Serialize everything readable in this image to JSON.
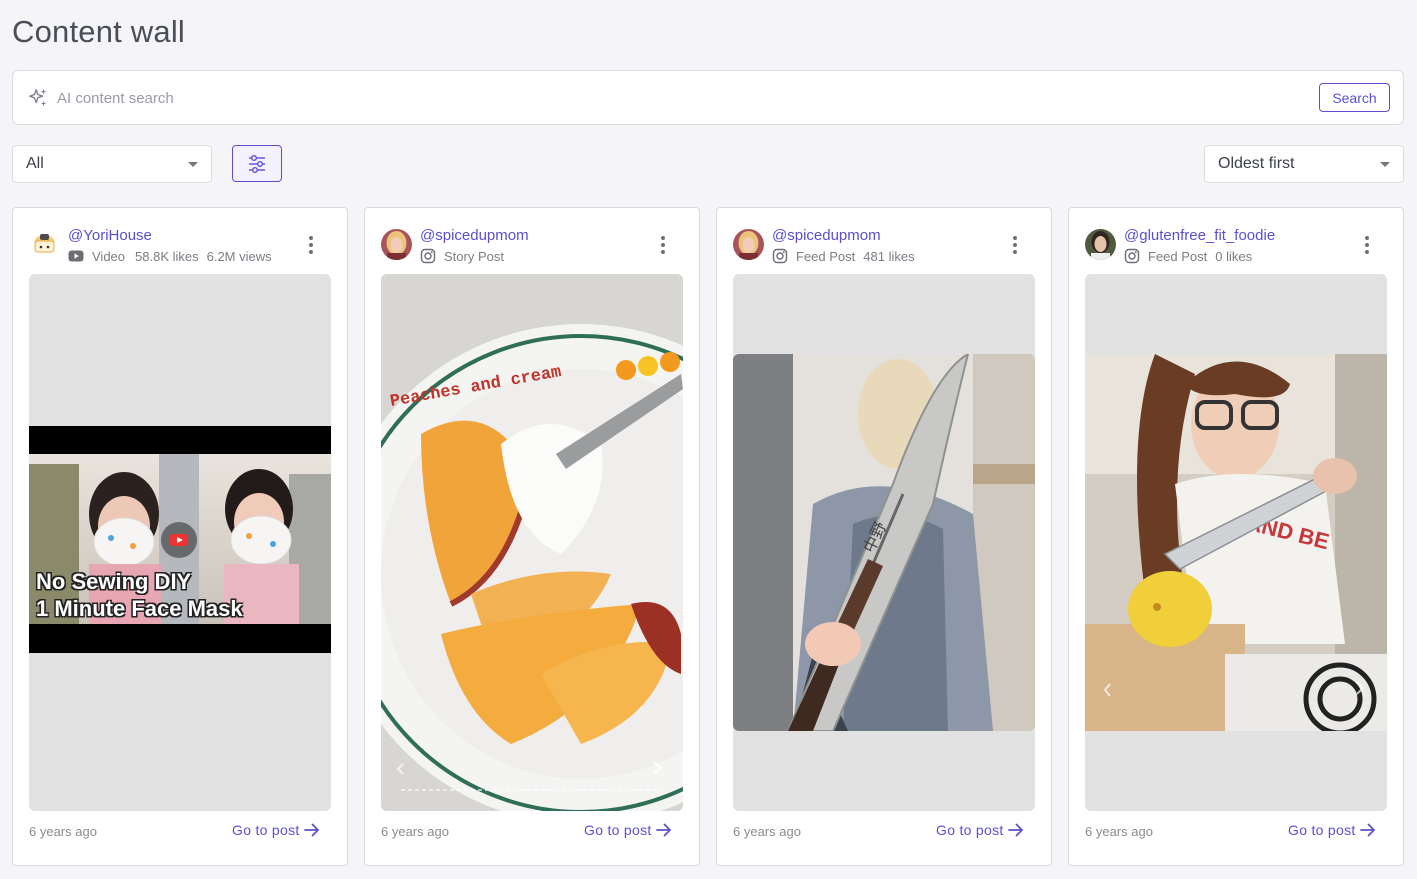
{
  "page": {
    "title": "Content wall"
  },
  "search": {
    "placeholder": "AI content search",
    "value": "",
    "button_label": "Search"
  },
  "filters": {
    "type_selected": "All",
    "sort_selected": "Oldest first"
  },
  "accent_color": "#5b4fd1",
  "cards": [
    {
      "handle": "@YoriHouse",
      "platform_icon": "youtube-icon",
      "post_type": "Video",
      "likes": "58.8K likes",
      "views": "6.2M views",
      "media_caption": [
        "No Sewing DIY",
        "1 Minute Face Mask"
      ],
      "posted": "6 years ago",
      "link_label": "Go to post"
    },
    {
      "handle": "@spicedupmom",
      "platform_icon": "instagram-icon",
      "post_type": "Story Post",
      "likes": "",
      "media_caption": [
        "Peaches and cream"
      ],
      "posted": "6 years ago",
      "link_label": "Go to post"
    },
    {
      "handle": "@spicedupmom",
      "platform_icon": "instagram-icon",
      "post_type": "Feed Post",
      "likes": "481 likes",
      "posted": "6 years ago",
      "link_label": "Go to post"
    },
    {
      "handle": "@glutenfree_fit_foodie",
      "platform_icon": "instagram-icon",
      "post_type": "Feed Post",
      "likes": "0 likes",
      "posted": "6 years ago",
      "link_label": "Go to post"
    }
  ]
}
